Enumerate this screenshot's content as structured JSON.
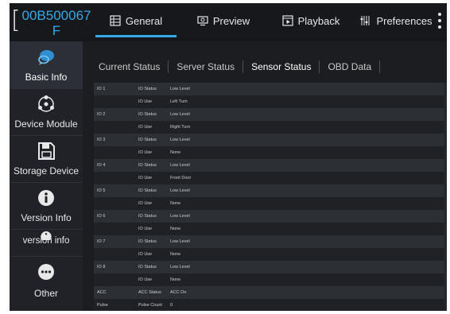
{
  "device": {
    "id_line1": "00B500067",
    "id_line2": "F"
  },
  "tabs": [
    {
      "label": "General",
      "icon": "grid-icon",
      "active": true
    },
    {
      "label": "Preview",
      "icon": "monitor-icon",
      "active": false
    },
    {
      "label": "Playback",
      "icon": "playback-icon",
      "active": false
    },
    {
      "label": "Preferences",
      "icon": "sliders-icon",
      "active": false
    }
  ],
  "sidebar": {
    "items": [
      {
        "label": "Basic Info",
        "icon": "chat-bubble-icon",
        "active": true
      },
      {
        "label": "Device Module",
        "icon": "network-icon",
        "active": false
      },
      {
        "label": "Storage Device",
        "icon": "floppy-disk-icon",
        "active": false
      },
      {
        "label": "Version Info",
        "icon": "info-icon",
        "active": false
      },
      {
        "label": "version info",
        "icon": "info-icon",
        "active": false
      },
      {
        "label": "Other",
        "icon": "more-circle-icon",
        "active": false
      }
    ]
  },
  "subtabs": [
    {
      "label": "Current Status",
      "active": false
    },
    {
      "label": "Server Status",
      "active": false
    },
    {
      "label": "Sensor Status",
      "active": true
    },
    {
      "label": "OBD Data",
      "active": false
    }
  ],
  "table": [
    {
      "io": "IO 1",
      "field": "IO Status",
      "value": "Low Level"
    },
    {
      "io": "",
      "field": "IO Use",
      "value": "Left Turn"
    },
    {
      "io": "IO 2",
      "field": "IO Status",
      "value": "Low Level"
    },
    {
      "io": "",
      "field": "IO Use",
      "value": "Right Turn"
    },
    {
      "io": "IO 3",
      "field": "IO Status",
      "value": "Low Level"
    },
    {
      "io": "",
      "field": "IO Use",
      "value": "None"
    },
    {
      "io": "IO 4",
      "field": "IO Status",
      "value": "Low Level"
    },
    {
      "io": "",
      "field": "IO Use",
      "value": "Front Door"
    },
    {
      "io": "IO 5",
      "field": "IO Status",
      "value": "Low Level"
    },
    {
      "io": "",
      "field": "IO Use",
      "value": "None"
    },
    {
      "io": "IO 6",
      "field": "IO Status",
      "value": "Low Level"
    },
    {
      "io": "",
      "field": "IO Use",
      "value": "None"
    },
    {
      "io": "IO 7",
      "field": "IO Status",
      "value": "Low Level"
    },
    {
      "io": "",
      "field": "IO Use",
      "value": "None"
    },
    {
      "io": "IO 8",
      "field": "IO Status",
      "value": "Low Level"
    },
    {
      "io": "",
      "field": "IO Use",
      "value": "None"
    },
    {
      "io": "ACC",
      "field": "ACC Status",
      "value": "ACC On"
    },
    {
      "io": "Pulse",
      "field": "Pulse Count",
      "value": "0"
    }
  ],
  "colors": {
    "accent": "#38a7e6",
    "background": "#1c1e22"
  }
}
